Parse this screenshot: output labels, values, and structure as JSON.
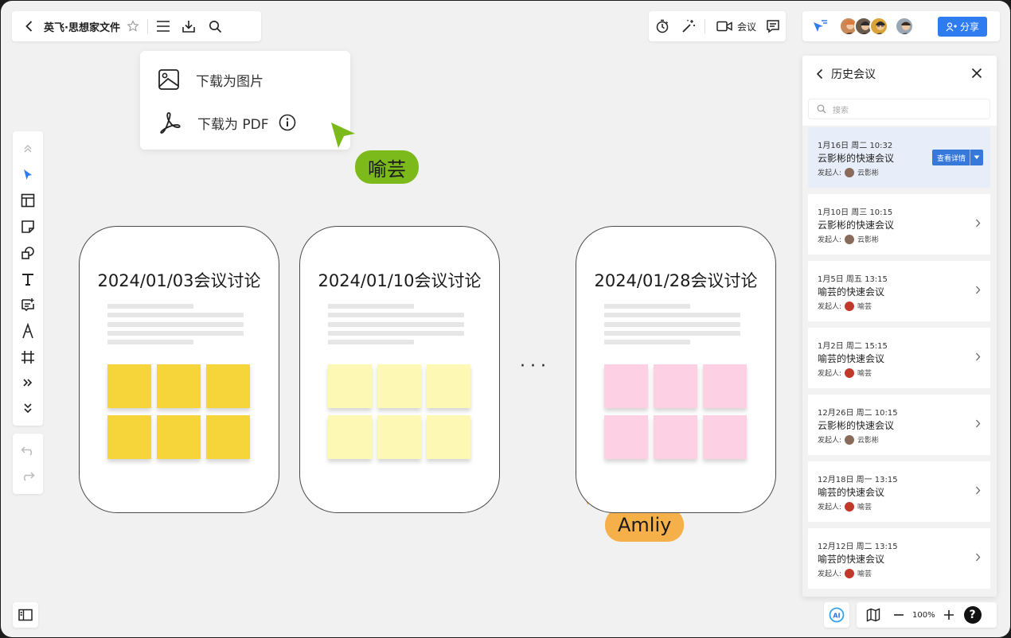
{
  "toolbar": {
    "doc_title": "英飞·思想家文件",
    "icons": [
      "back-icon",
      "star-icon",
      "menu-icon",
      "download-icon",
      "search-icon"
    ]
  },
  "download_menu": {
    "image_label": "下载为图片",
    "pdf_label": "下载为 PDF"
  },
  "cursors": {
    "green": {
      "name": "喻芸",
      "color": "#7cba1c"
    },
    "orange": {
      "name": "Amliy",
      "color": "#f5b04a"
    }
  },
  "cards": [
    {
      "title": "2024/01/03会议讨论",
      "sticky_color": "#f5d53a"
    },
    {
      "title": "2024/01/10会议讨论",
      "sticky_color": "#fdf8b4"
    },
    {
      "title": "2024/01/28会议讨论",
      "sticky_color": "#fdd0e3"
    }
  ],
  "ellipsis": "···",
  "meeting_toolbar": {
    "meeting_label": "会议"
  },
  "share": {
    "label": "分享"
  },
  "history": {
    "title": "历史会议",
    "search_placeholder": "搜索",
    "host_prefix": "发起人:",
    "detail_label": "查看详情",
    "meetings": [
      {
        "date": "1月16日  周二  10:32",
        "name": "云影彬的快速会议",
        "host": "云影彬",
        "active": true
      },
      {
        "date": "1月10日  周三  10:15",
        "name": "云影彬的快速会议",
        "host": "云影彬",
        "active": false
      },
      {
        "date": "1月5日  周五  13:15",
        "name": "喻芸的快速会议",
        "host": "喻芸",
        "active": false
      },
      {
        "date": "1月2日  周二  15:15",
        "name": "喻芸的快速会议",
        "host": "喻芸",
        "active": false
      },
      {
        "date": "12月26日  周二  10:15",
        "name": "云影彬的快速会议",
        "host": "云影彬",
        "active": false
      },
      {
        "date": "12月18日  周一  13:15",
        "name": "喻芸的快速会议",
        "host": "喻芸",
        "active": false
      },
      {
        "date": "12月12日  周二  13:15",
        "name": "喻芸的快速会议",
        "host": "喻芸",
        "active": false
      }
    ]
  },
  "zoom": {
    "value": "100%",
    "help": "?"
  },
  "colors": {
    "accent": "#2f7bf0",
    "canvas": "#f1f1f1"
  }
}
